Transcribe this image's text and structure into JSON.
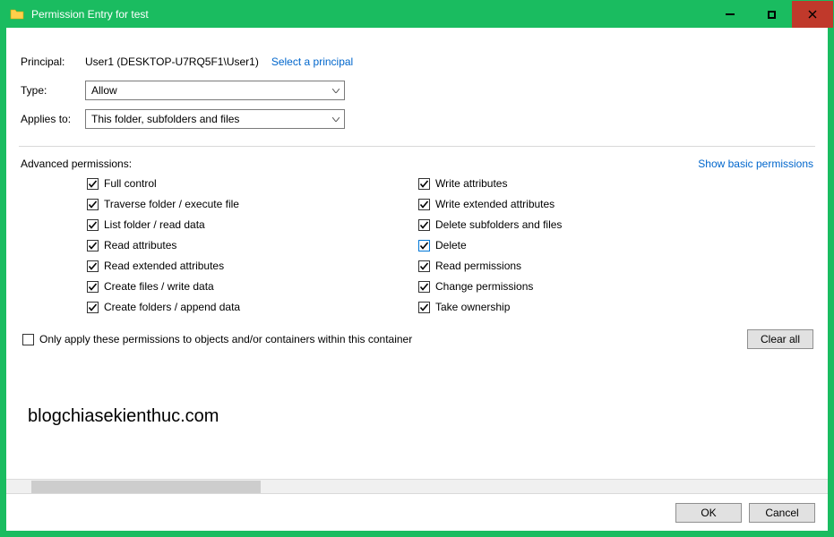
{
  "window": {
    "title": "Permission Entry for test"
  },
  "form": {
    "principal_label": "Principal:",
    "principal_value": "User1 (DESKTOP-U7RQ5F1\\User1)",
    "select_principal": "Select a principal",
    "type_label": "Type:",
    "type_value": "Allow",
    "applies_label": "Applies to:",
    "applies_value": "This folder, subfolders and files"
  },
  "permissions": {
    "header": "Advanced permissions:",
    "show_basic": "Show basic permissions",
    "col1": [
      {
        "label": "Full control",
        "checked": true
      },
      {
        "label": "Traverse folder / execute file",
        "checked": true
      },
      {
        "label": "List folder / read data",
        "checked": true
      },
      {
        "label": "Read attributes",
        "checked": true
      },
      {
        "label": "Read extended attributes",
        "checked": true
      },
      {
        "label": "Create files / write data",
        "checked": true
      },
      {
        "label": "Create folders / append data",
        "checked": true
      }
    ],
    "col2": [
      {
        "label": "Write attributes",
        "checked": true,
        "highlight": false
      },
      {
        "label": "Write extended attributes",
        "checked": true,
        "highlight": false
      },
      {
        "label": "Delete subfolders and files",
        "checked": true,
        "highlight": false
      },
      {
        "label": "Delete",
        "checked": true,
        "highlight": true
      },
      {
        "label": "Read permissions",
        "checked": true,
        "highlight": false
      },
      {
        "label": "Change permissions",
        "checked": true,
        "highlight": false
      },
      {
        "label": "Take ownership",
        "checked": true,
        "highlight": false
      }
    ],
    "only_apply": "Only apply these permissions to objects and/or containers within this container",
    "only_apply_checked": false,
    "clear_all": "Clear all"
  },
  "watermark": "blogchiasekienthuc.com",
  "footer": {
    "ok": "OK",
    "cancel": "Cancel"
  }
}
